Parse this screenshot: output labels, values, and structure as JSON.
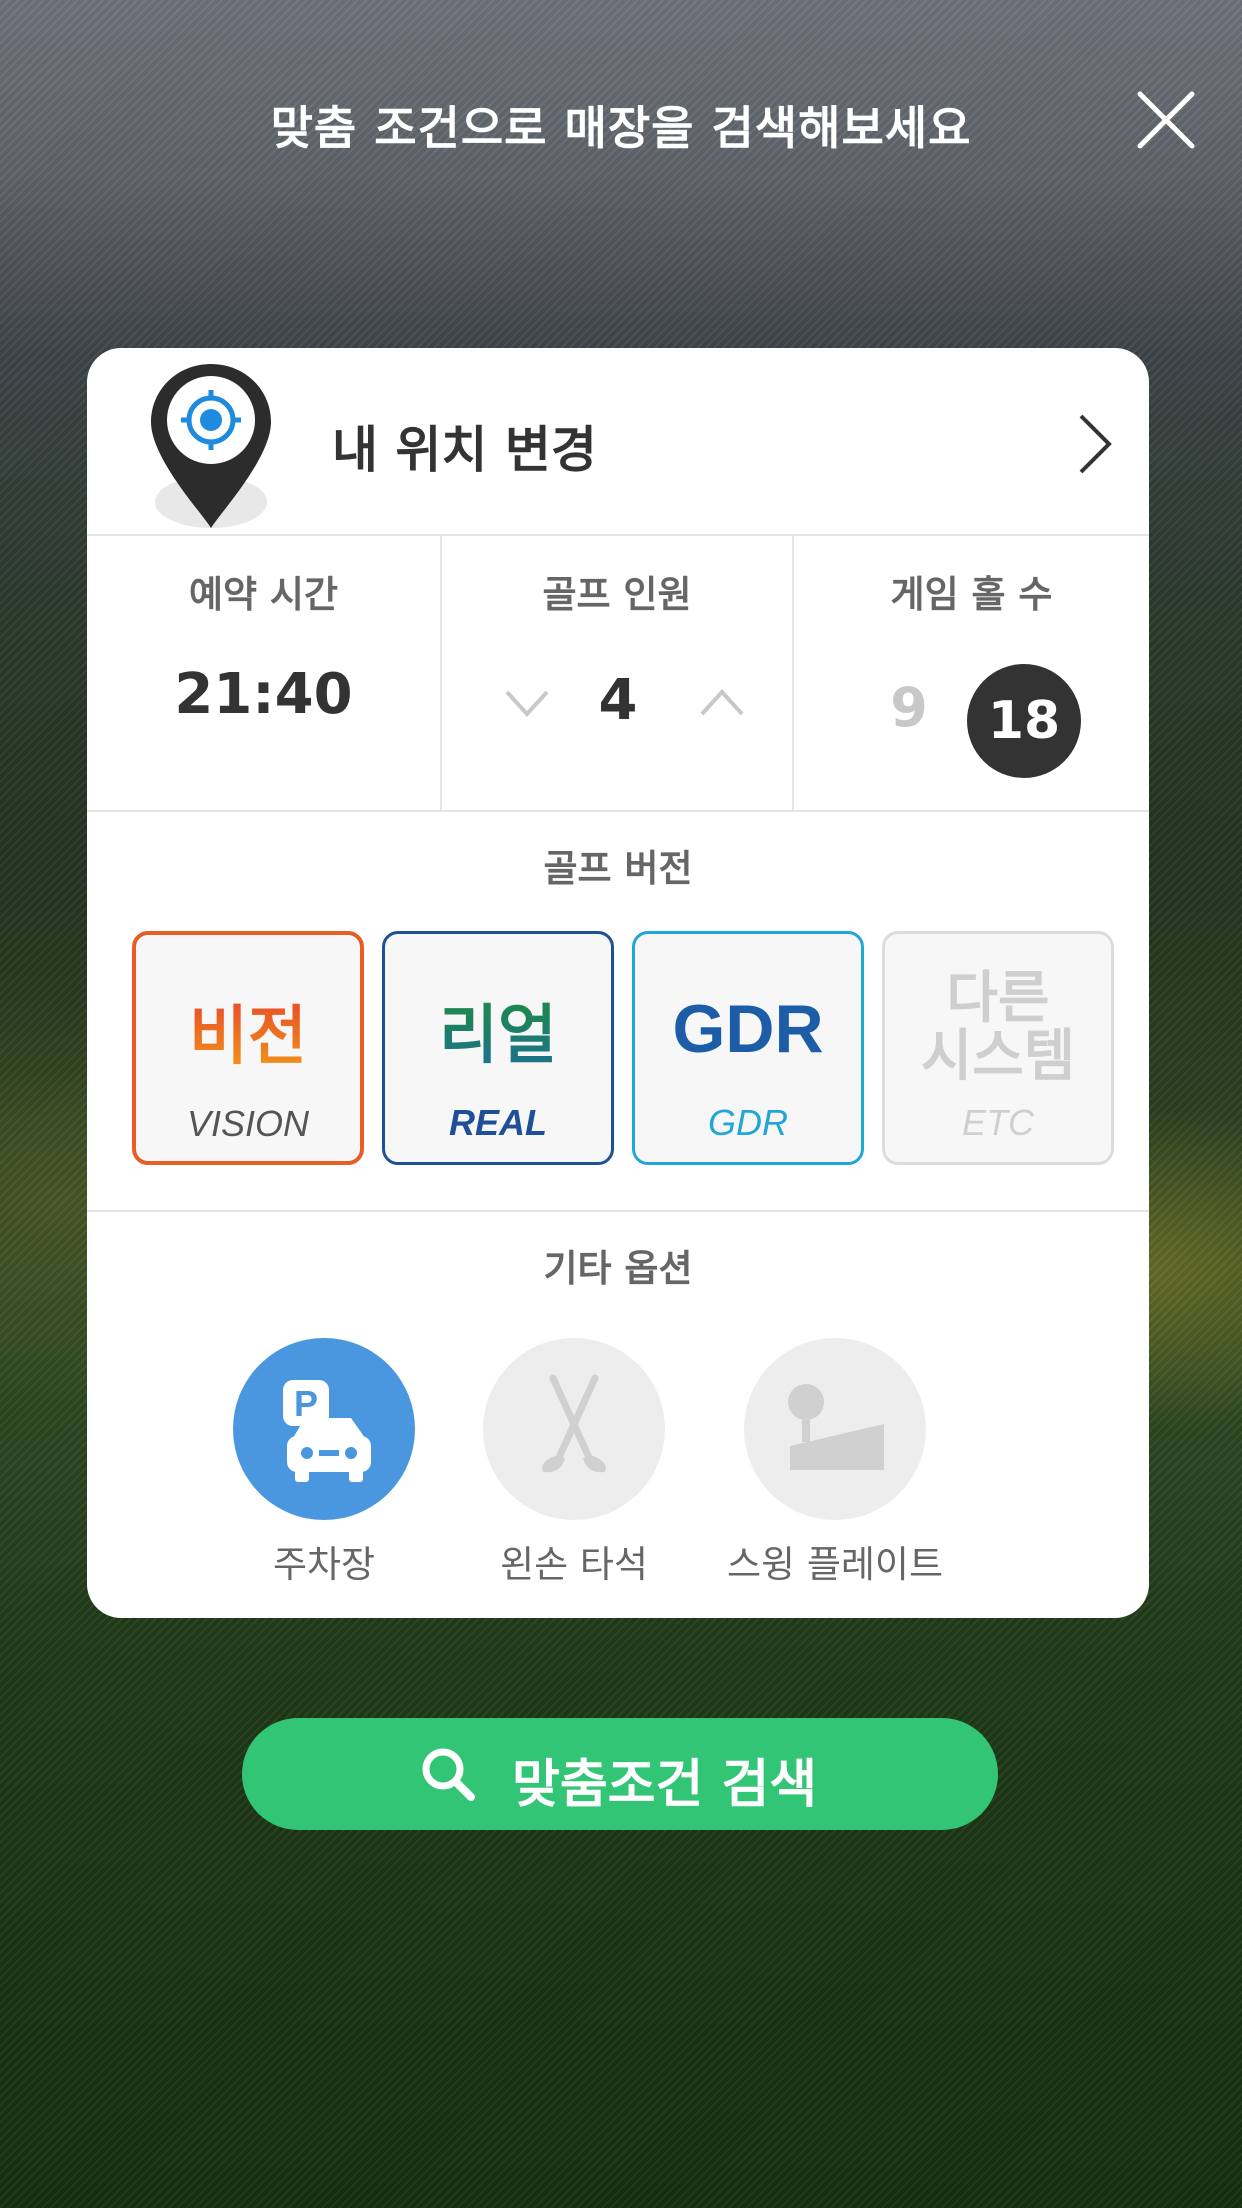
{
  "header": {
    "title": "맞춤 조건으로 매장을 검색해보세요",
    "close_icon": "close-icon"
  },
  "location": {
    "label": "내 위치 변경",
    "icon": "location-pin-icon"
  },
  "booking": {
    "time_label": "예약 시간",
    "time_value": "21:40",
    "players_label": "골프 인원",
    "players_value": "4",
    "holes_label": "게임 홀 수",
    "holes_options": [
      "9",
      "18"
    ],
    "holes_selected": "18"
  },
  "version": {
    "title": "골프 버전",
    "items": [
      {
        "ko": "비전",
        "en": "VISION",
        "selected": true
      },
      {
        "ko": "리얼",
        "en": "REAL",
        "selected": true
      },
      {
        "ko": "GDR",
        "en": "GDR",
        "selected": true
      },
      {
        "ko": "다른\n시스템",
        "en": "ETC",
        "selected": false
      }
    ]
  },
  "options": {
    "title": "기타 옵션",
    "items": [
      {
        "label": "주차장",
        "icon": "parking-car-icon",
        "selected": true
      },
      {
        "label": "왼손 타석",
        "icon": "golf-clubs-icon",
        "selected": false
      },
      {
        "label": "스윙 플레이트",
        "icon": "swing-plate-icon",
        "selected": false
      }
    ]
  },
  "search_button": {
    "label": "맞춤조건 검색",
    "icon": "search-icon"
  },
  "colors": {
    "accent_green": "#32c575",
    "selected_blue": "#4a97e0",
    "vision_orange": "#e85c28",
    "real_navy": "#1f4f97",
    "gdr_cyan": "#22a6d6"
  }
}
